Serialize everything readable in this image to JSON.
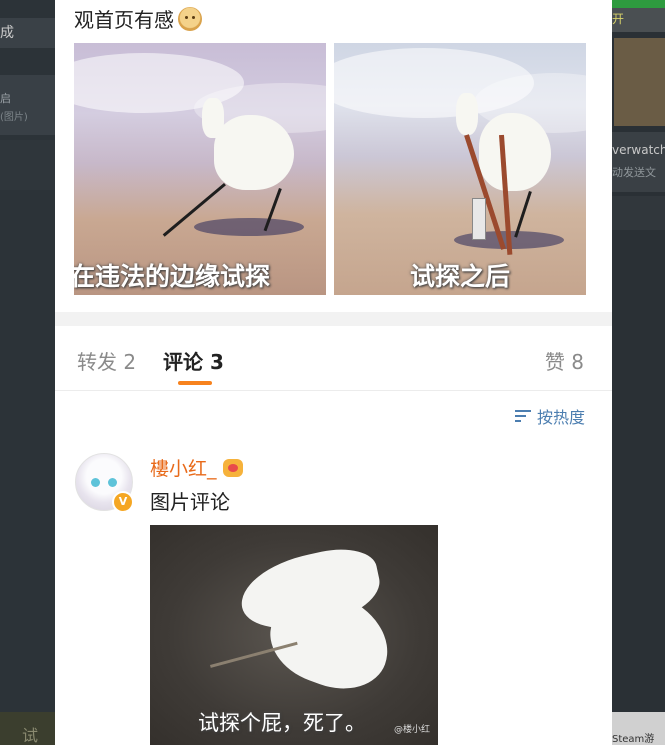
{
  "background": {
    "left": {
      "title": "成",
      "line1": "启",
      "line2": "(图片)",
      "bottom": "试"
    },
    "right": {
      "top_tag": "开",
      "item_title": "verwatch",
      "item_sub": "动发送文",
      "bottom_text": "Steam游"
    }
  },
  "post": {
    "text": "观首页有感",
    "emoji": "doge-emoji",
    "images": [
      {
        "caption": "在违法的边缘试探"
      },
      {
        "caption": "试探之后"
      }
    ]
  },
  "tabs": {
    "repost_label": "转发",
    "repost_count": "2",
    "comment_label": "评论",
    "comment_count": "3",
    "like_label": "赞",
    "like_count": "8",
    "active": "comment"
  },
  "sort": {
    "label": "按热度"
  },
  "comments": [
    {
      "username": "樓小红_",
      "text": "图片评论",
      "image_caption": "试探个屁，死了。",
      "watermark": "@楼小红"
    }
  ],
  "colors": {
    "accent_orange": "#f7821d",
    "username": "#e86a1a",
    "link_blue": "#4c7eb0",
    "muted": "#8a8a8a"
  }
}
